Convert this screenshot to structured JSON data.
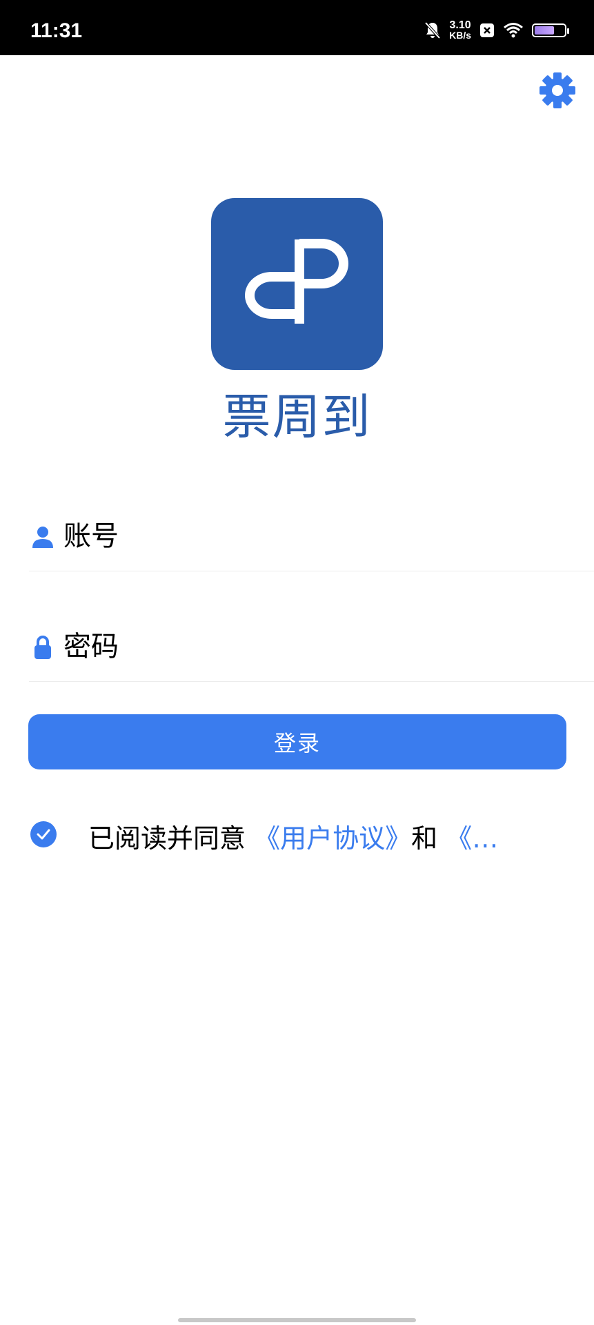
{
  "status_bar": {
    "time": "11:31",
    "net_speed_value": "3.10",
    "net_speed_unit": "KB/s",
    "icons": [
      "bell-muted-icon",
      "x-badge-icon",
      "wifi-icon",
      "battery-icon"
    ]
  },
  "header": {
    "settings_icon": "gear-icon"
  },
  "logo": {
    "mark": "dP",
    "name": "票周到",
    "color": "#2a5caa"
  },
  "form": {
    "account_placeholder": "账号",
    "password_placeholder": "密码",
    "login_label": "登录"
  },
  "agreement": {
    "prefix": "已阅读并同意",
    "user_agreement": "《用户协议》",
    "and": "和",
    "truncated": "《…"
  },
  "colors": {
    "accent": "#3a7cee",
    "brand": "#2a5caa"
  }
}
